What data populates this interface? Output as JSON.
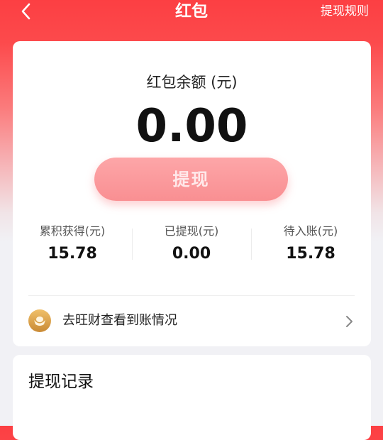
{
  "header": {
    "title": "红包",
    "rules_link": "提现规则"
  },
  "balance": {
    "label": "红包余额 (元)",
    "value": "0.00"
  },
  "withdraw_button": "提现",
  "stats": [
    {
      "label": "累积获得(元)",
      "value": "15.78"
    },
    {
      "label": "已提现(元)",
      "value": "0.00"
    },
    {
      "label": "待入账(元)",
      "value": "15.78"
    }
  ],
  "wangcai": {
    "text": "去旺财查看到账情况",
    "icon": "gold-ingot-icon"
  },
  "records": {
    "title": "提现记录"
  },
  "colors": {
    "header_red": "#fc3f43",
    "button_pink": "#f98f92",
    "page_bg": "#f1f1f5",
    "coin_gold": "#d8a04a"
  }
}
